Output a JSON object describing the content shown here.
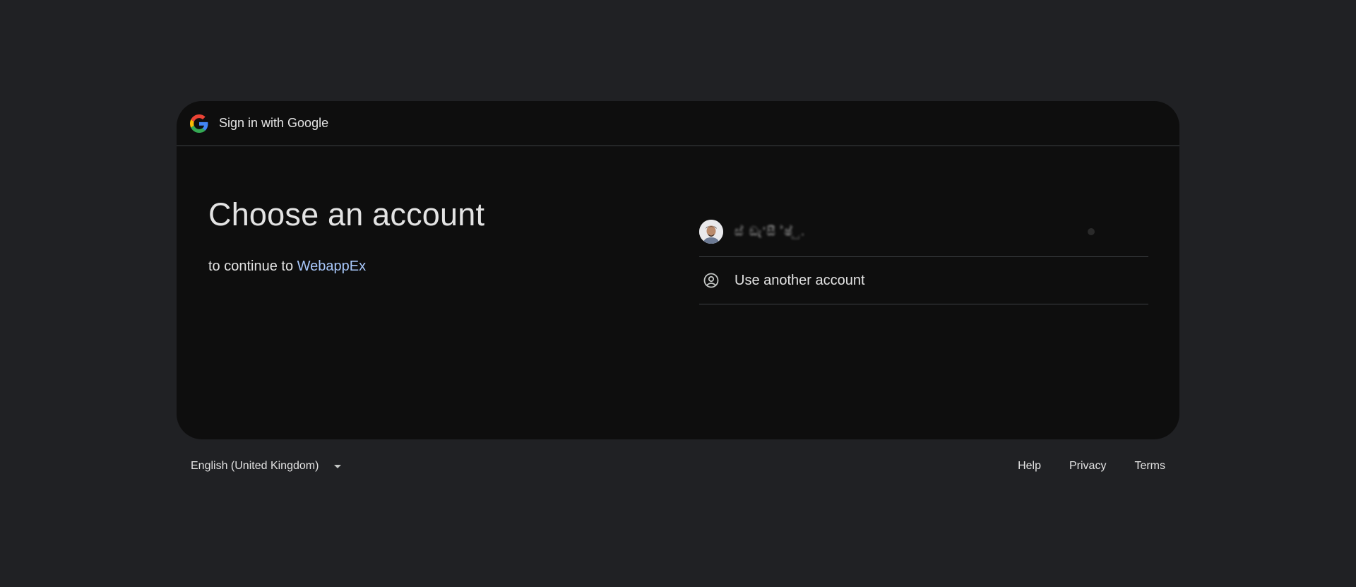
{
  "header": {
    "title": "Sign in with Google",
    "logo": "google-g-logo"
  },
  "main": {
    "heading": "Choose an account",
    "subheading_prefix": "to continue to",
    "app_name": "WebappEx"
  },
  "accounts": {
    "items": [
      {
        "name": "ස් ඞැ'සී ්ෂ් ු.",
        "avatar_icon": "user-photo-avatar"
      }
    ],
    "use_another_label": "Use another account",
    "use_another_icon": "account-circle-icon"
  },
  "footer": {
    "language": "English (United Kingdom)",
    "links": {
      "help": "Help",
      "privacy": "Privacy",
      "terms": "Terms"
    }
  },
  "colors": {
    "background": "#202124",
    "card": "#0e0e0e",
    "link": "#a8c7fa",
    "divider": "#3c4043"
  }
}
